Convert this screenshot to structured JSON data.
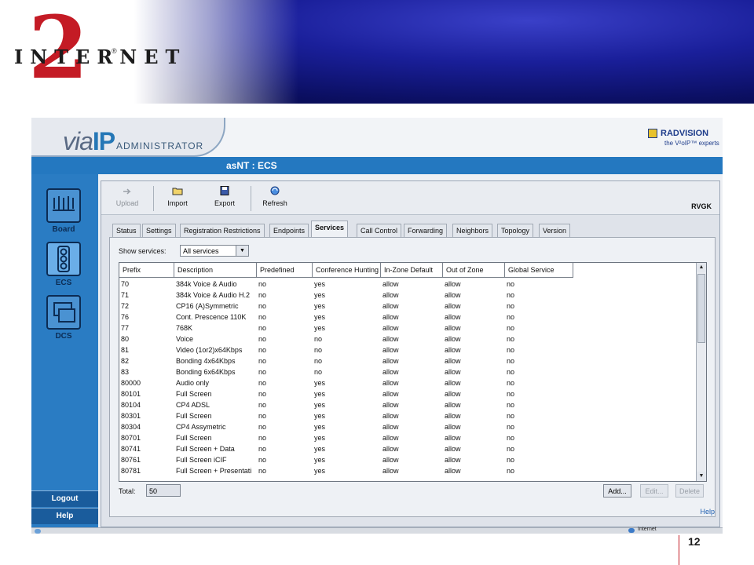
{
  "slide": {
    "logo_word": "INTERNET",
    "logo_numeral": "2",
    "logo_mark": "®",
    "page_number": "12"
  },
  "app": {
    "brand_left": "via",
    "brand_right": "IP",
    "brand_sub": "ADMINISTRATOR",
    "vendor": "RADVISION",
    "vendor_tagline": "the V²oIP™ experts",
    "title": "asNT : ECS",
    "gatekeeper": "RVGK",
    "help": "Help",
    "status_zone": "Internet"
  },
  "sidebar": {
    "items": [
      {
        "label": "Board",
        "icon": "board-icon"
      },
      {
        "label": "ECS",
        "icon": "traffic-light-icon"
      },
      {
        "label": "DCS",
        "icon": "dcs-icon"
      }
    ],
    "logout": "Logout",
    "help": "Help"
  },
  "toolbar": {
    "upload": "Upload",
    "import": "Import",
    "export": "Export",
    "refresh": "Refresh"
  },
  "tabs": [
    "Status",
    "Settings",
    "Registration Restrictions",
    "Endpoints",
    "Services",
    "Call Control",
    "Forwarding",
    "Neighbors",
    "Topology",
    "Version"
  ],
  "active_tab": "Services",
  "filter": {
    "label": "Show services:",
    "value": "All services"
  },
  "table": {
    "columns": [
      "Prefix",
      "Description",
      "Predefined",
      "Conference Hunting",
      "In-Zone Default",
      "Out of Zone",
      "Global Service"
    ],
    "rows": [
      [
        "70",
        "384k Voice & Audio",
        "no",
        "yes",
        "allow",
        "allow",
        "no"
      ],
      [
        "71",
        "384k Voice & Audio H.2",
        "no",
        "yes",
        "allow",
        "allow",
        "no"
      ],
      [
        "72",
        "CP16 (A)Symmetric",
        "no",
        "yes",
        "allow",
        "allow",
        "no"
      ],
      [
        "76",
        "Cont. Prescence 110K",
        "no",
        "yes",
        "allow",
        "allow",
        "no"
      ],
      [
        "77",
        "768K",
        "no",
        "yes",
        "allow",
        "allow",
        "no"
      ],
      [
        "80",
        "Voice",
        "no",
        "no",
        "allow",
        "allow",
        "no"
      ],
      [
        "81",
        "Video (1or2)x64Kbps",
        "no",
        "no",
        "allow",
        "allow",
        "no"
      ],
      [
        "82",
        "Bonding 4x64Kbps",
        "no",
        "no",
        "allow",
        "allow",
        "no"
      ],
      [
        "83",
        "Bonding 6x64Kbps",
        "no",
        "no",
        "allow",
        "allow",
        "no"
      ],
      [
        "80000",
        "Audio only",
        "no",
        "yes",
        "allow",
        "allow",
        "no"
      ],
      [
        "80101",
        "Full Screen",
        "no",
        "yes",
        "allow",
        "allow",
        "no"
      ],
      [
        "80104",
        "CP4 ADSL",
        "no",
        "yes",
        "allow",
        "allow",
        "no"
      ],
      [
        "80301",
        "Full Screen",
        "no",
        "yes",
        "allow",
        "allow",
        "no"
      ],
      [
        "80304",
        "CP4 Assymetric",
        "no",
        "yes",
        "allow",
        "allow",
        "no"
      ],
      [
        "80701",
        "Full Screen",
        "no",
        "yes",
        "allow",
        "allow",
        "no"
      ],
      [
        "80741",
        "Full Screen + Data",
        "no",
        "yes",
        "allow",
        "allow",
        "no"
      ],
      [
        "80761",
        "Full Screen iCIF",
        "no",
        "yes",
        "allow",
        "allow",
        "no"
      ],
      [
        "80781",
        "Full Screen + Presentati",
        "no",
        "yes",
        "allow",
        "allow",
        "no"
      ]
    ]
  },
  "footer": {
    "total_label": "Total:",
    "total_value": "50",
    "add": "Add...",
    "edit": "Edit...",
    "delete": "Delete"
  }
}
